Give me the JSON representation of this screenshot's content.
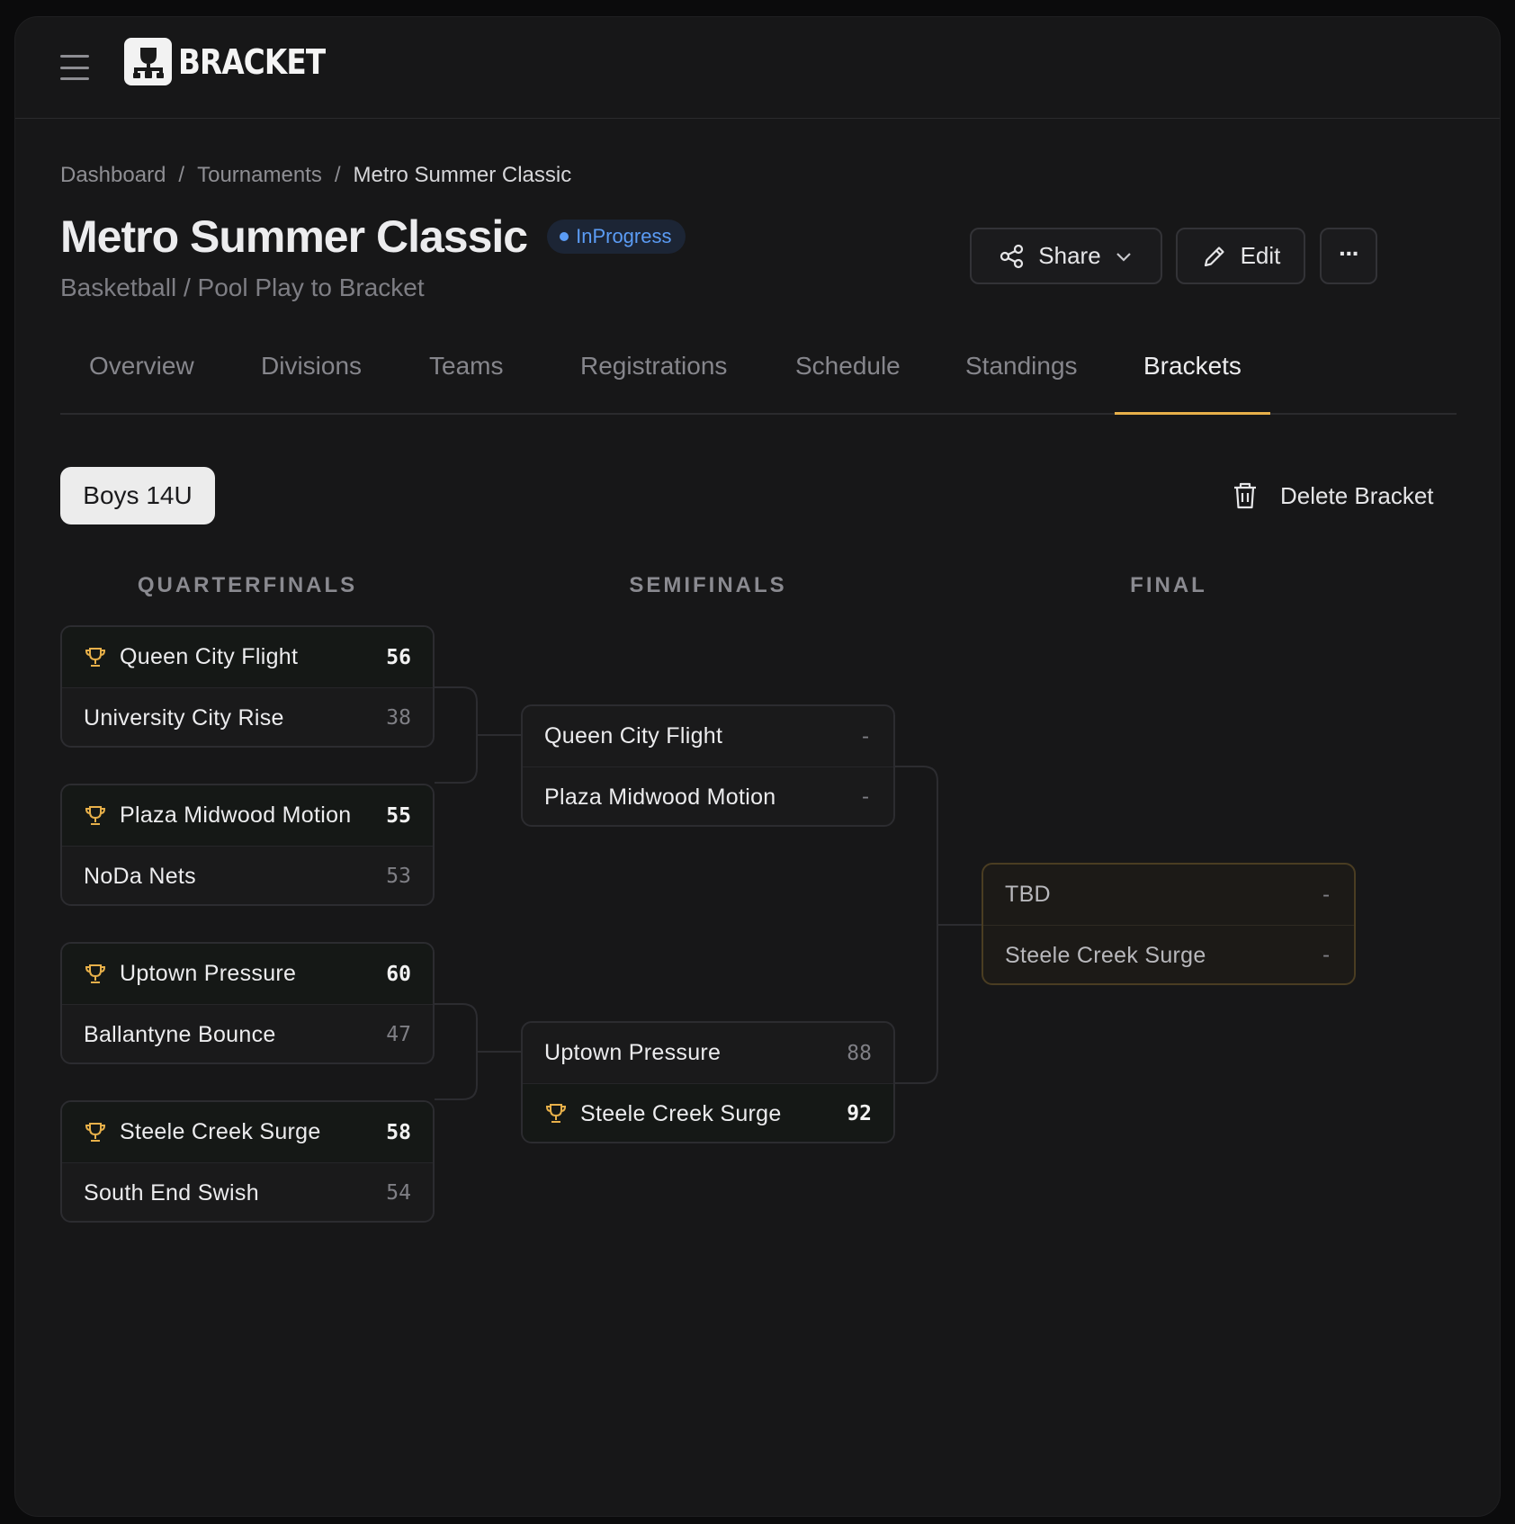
{
  "app": {
    "brand": "BRACKET"
  },
  "breadcrumb": {
    "items": [
      "Dashboard",
      "Tournaments"
    ],
    "separator": "/",
    "current": "Metro Summer Classic"
  },
  "tournament": {
    "title": "Metro Summer Classic",
    "status": "InProgress",
    "subtitle": "Basketball / Pool Play to Bracket"
  },
  "actions": {
    "share": "Share",
    "edit": "Edit",
    "more": "···"
  },
  "tabs": [
    "Overview",
    "Divisions",
    "Teams",
    "Registrations",
    "Schedule",
    "Standings",
    "Brackets"
  ],
  "active_tab": "Brackets",
  "division": {
    "selected": "Boys 14U"
  },
  "delete_label": "Delete Bracket",
  "rounds": [
    "QUARTERFINALS",
    "SEMIFINALS",
    "FINAL"
  ],
  "quarterfinals": [
    {
      "top": {
        "name": "Queen City Flight",
        "score": "56",
        "winner": true
      },
      "bottom": {
        "name": "University City Rise",
        "score": "38",
        "winner": false
      }
    },
    {
      "top": {
        "name": "Plaza Midwood Motion",
        "score": "55",
        "winner": true
      },
      "bottom": {
        "name": "NoDa Nets",
        "score": "53",
        "winner": false
      }
    },
    {
      "top": {
        "name": "Uptown Pressure",
        "score": "60",
        "winner": true
      },
      "bottom": {
        "name": "Ballantyne Bounce",
        "score": "47",
        "winner": false
      }
    },
    {
      "top": {
        "name": "Steele Creek Surge",
        "score": "58",
        "winner": true
      },
      "bottom": {
        "name": "South End Swish",
        "score": "54",
        "winner": false
      }
    }
  ],
  "semifinals": [
    {
      "top": {
        "name": "Queen City Flight",
        "score": "-",
        "winner": false
      },
      "bottom": {
        "name": "Plaza Midwood Motion",
        "score": "-",
        "winner": false
      }
    },
    {
      "top": {
        "name": "Uptown Pressure",
        "score": "88",
        "winner": false
      },
      "bottom": {
        "name": "Steele Creek Surge",
        "score": "92",
        "winner": true
      }
    }
  ],
  "final": {
    "top": {
      "name": "TBD",
      "score": "-"
    },
    "bottom": {
      "name": "Steele Creek Surge",
      "score": "-"
    }
  },
  "colors": {
    "accent": "#e7b04a",
    "status": "#5b9cf5",
    "background": "#171718"
  }
}
